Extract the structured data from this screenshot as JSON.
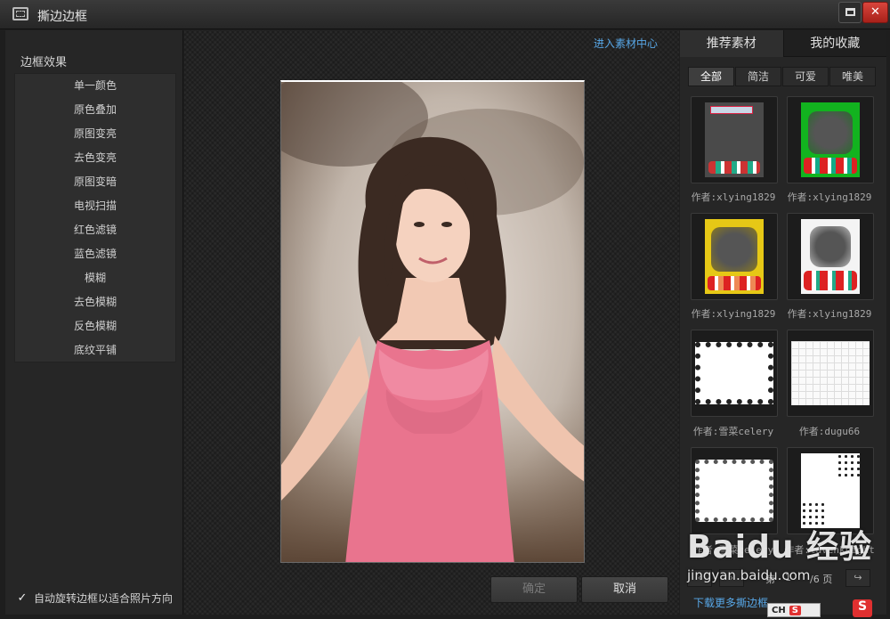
{
  "window": {
    "title": "撕边边框"
  },
  "left": {
    "heading": "边框效果",
    "effects": [
      "单一颜色",
      "原色叠加",
      "原图变亮",
      "去色变亮",
      "原图变暗",
      "电视扫描",
      "红色滤镜",
      "蓝色滤镜",
      "模糊",
      "去色模糊",
      "反色模糊",
      "底纹平铺"
    ],
    "auto_rotate_label": "自动旋转边框以适合照片方向",
    "auto_rotate_checked": true
  },
  "center": {
    "material_link": "进入素材中心",
    "ok_label": "确定",
    "cancel_label": "取消"
  },
  "right": {
    "tabs": [
      "推荐素材",
      "我的收藏"
    ],
    "filters": [
      "全部",
      "简洁",
      "可爱",
      "唯美"
    ],
    "cards": [
      {
        "author": "作者:xlying1829",
        "style": "dark-christmas"
      },
      {
        "author": "作者:xlying1829",
        "style": "green-christmas"
      },
      {
        "author": "作者:xlying1829",
        "style": "yellow-christmas"
      },
      {
        "author": "作者:xlying1829",
        "style": "candy-christmas"
      },
      {
        "author": "作者:雪菜celery",
        "style": "splatter-frame"
      },
      {
        "author": "作者:dugu66",
        "style": "grid-frame"
      },
      {
        "author": "作者:雪菜celery",
        "style": "bubble-frame"
      },
      {
        "author": "作者:lavenknight",
        "style": "snowflake-corner"
      }
    ],
    "pager": {
      "page_prefix": "第",
      "page": "1",
      "total": "/6 页"
    },
    "download_link": "下载更多撕边框"
  },
  "watermark": {
    "logo": "Baidu 经验",
    "site": "jingyan.baidu.com"
  },
  "taskbar": {
    "ime_label": "CH",
    "ime_badge": "S"
  },
  "colors": {
    "link": "#58a8e8",
    "close": "#c8322a"
  }
}
